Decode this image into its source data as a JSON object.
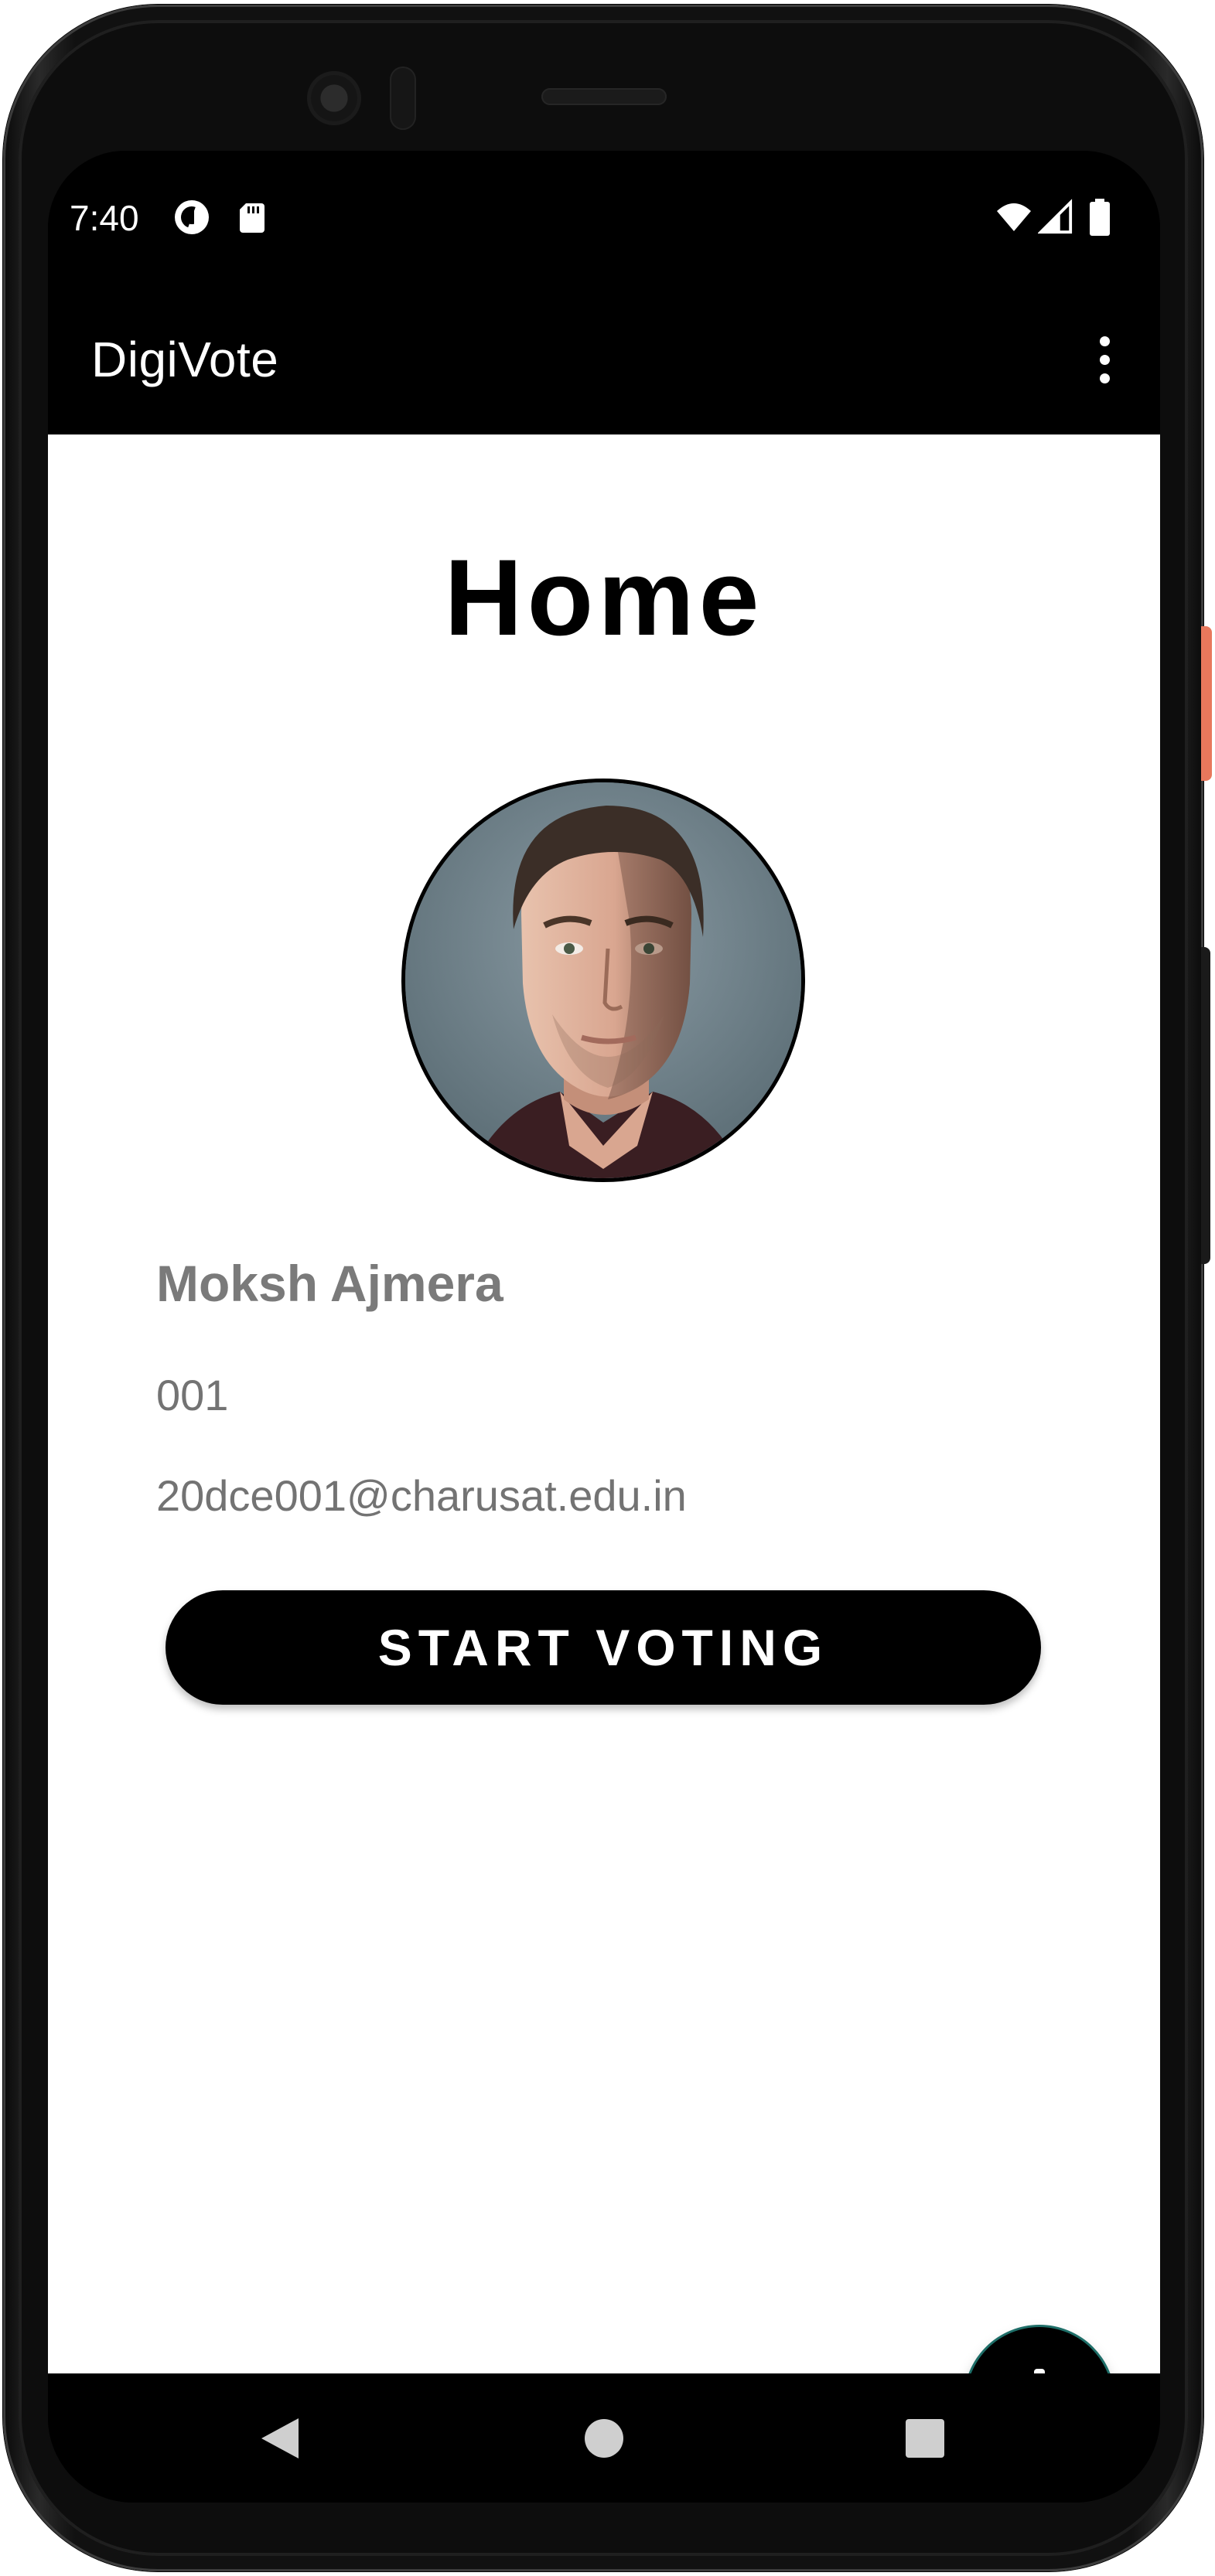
{
  "status_bar": {
    "time": "7:40",
    "left_icons": [
      "data-saver-icon",
      "sd-card-icon"
    ],
    "right_icons": [
      "wifi-icon",
      "signal-icon",
      "battery-icon"
    ]
  },
  "app_bar": {
    "title": "DigiVote",
    "menu_icon": "more-vert-icon"
  },
  "home": {
    "title": "Home",
    "profile": {
      "name": "Moksh Ajmera",
      "id": "001",
      "email": "20dce001@charusat.edu.in"
    },
    "start_button_label": "START VOTING",
    "fab_icon": "add-icon"
  },
  "nav_bar": {
    "buttons": [
      "back-icon",
      "home-icon",
      "recents-icon"
    ]
  },
  "colors": {
    "app_bar": "#000000",
    "background": "#ffffff",
    "button": "#000000",
    "secondary_text": "#737373",
    "fab_outline": "#1e6e68"
  }
}
